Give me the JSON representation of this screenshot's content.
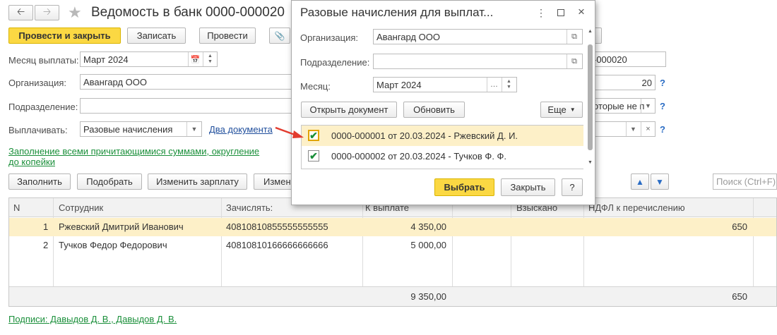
{
  "window": {
    "title": "Ведомость в банк 0000-000020"
  },
  "toolbar": {
    "post_close": "Провести и закрыть",
    "save": "Записать",
    "post": "Провести"
  },
  "form": {
    "month_label": "Месяц выплаты:",
    "month_value": "Март 2024",
    "org_label": "Организация:",
    "org_value": "Авангард ООО",
    "dept_label": "Подразделение:",
    "dept_value": "",
    "pay_label": "Выплачивать:",
    "pay_value": "Разовые начисления",
    "docs_link": "Два документа",
    "fill_link_1": "Заполнение всеми причитающимися суммами, округление",
    "fill_link_2": "до копейки",
    "number_value": "-000020",
    "number_20": "20",
    "which_value": "оторые не п",
    "help": "?"
  },
  "actions": {
    "fill": "Заполнить",
    "pick": "Подобрать",
    "change_salary": "Изменить зарплату",
    "change_partial": "Измен",
    "search_placeholder": "Поиск (Ctrl+F)"
  },
  "table": {
    "headers": [
      "N",
      "Сотрудник",
      "Зачислять:",
      "К выплате",
      "Взыскано",
      "НДФЛ к перечислению"
    ],
    "rows": [
      {
        "n": "1",
        "employee": "Ржевский Дмитрий Иванович",
        "account": "40810810855555555555",
        "pay": "4 350,00",
        "tax": "650"
      },
      {
        "n": "2",
        "employee": "Тучков Федор Федорович",
        "account": "40810810166666666666",
        "pay": "5 000,00",
        "tax": ""
      }
    ],
    "total_pay": "9 350,00",
    "total_tax": "650"
  },
  "footer": {
    "signatures": "Подписи: Давыдов Д. В., Давыдов Д. В."
  },
  "dialog": {
    "title": "Разовые начисления для выплат...",
    "org_label": "Организация:",
    "org_value": "Авангард ООО",
    "dept_label": "Подразделение:",
    "dept_value": "",
    "month_label": "Месяц:",
    "month_value": "Март 2024",
    "open_doc": "Открыть документ",
    "refresh": "Обновить",
    "more": "Еще",
    "items": [
      {
        "label": "0000-000001 от 20.03.2024 - Ржевский Д. И.",
        "checked": true
      },
      {
        "label": "0000-000002 от 20.03.2024 - Тучков Ф. Ф.",
        "checked": true
      }
    ],
    "select": "Выбрать",
    "close": "Закрыть",
    "help": "?"
  },
  "colors": {
    "accent_yellow": "#fbd843",
    "selected_row": "#fdf0c8",
    "link_green": "#1a8f3a",
    "link_blue": "#1f4e9c",
    "arrow_red": "#e23b2e"
  }
}
